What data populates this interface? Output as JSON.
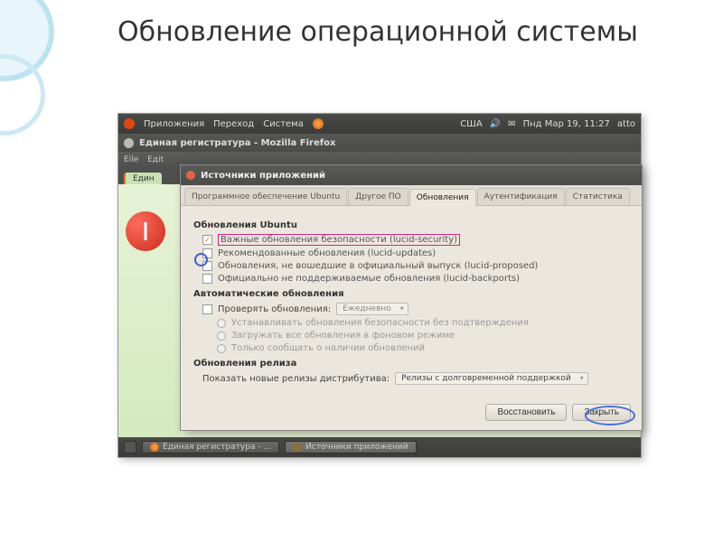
{
  "slide": {
    "title": "Обновление операционной системы"
  },
  "top_panel": {
    "menu": [
      "Приложения",
      "Переход",
      "Система"
    ],
    "status_lang": "США",
    "datetime": "Пнд Мар 19, 11:27",
    "user": "atto"
  },
  "firefox": {
    "title": "Единая регистратура - Mozilla Firefox",
    "menu": [
      "Eile",
      "Едit"
    ],
    "tab": "Един"
  },
  "dialog": {
    "title": "Источники приложений",
    "tabs": [
      "Программное обеспечение Ubuntu",
      "Другое ПО",
      "Обновления",
      "Аутентификация",
      "Статистика"
    ],
    "active_tab": 2,
    "section_updates": "Обновления Ubuntu",
    "opt_security": "Важные обновления безопасности (lucid-security)",
    "opt_recommended": "Рекомендованные обновления (lucid-updates)",
    "opt_proposed": "Обновления, не вошедшие в официальный выпуск (lucid-proposed)",
    "opt_backports": "Официально не поддерживаемые обновления (lucid-backports)",
    "section_auto": "Автоматические обновления",
    "check_label": "Проверять обновления:",
    "check_interval": "Ежедневно",
    "r_install": "Устанавливать обновления безопасности без подтверждения",
    "r_download": "Загружать все обновления в фоновом режиме",
    "r_notify": "Только сообщать о наличии обновлений",
    "section_release": "Обновления релиза",
    "release_label": "Показать новые релизы дистрибутива:",
    "release_value": "Релизы с долговременной поддержкой",
    "btn_restore": "Восстановить",
    "btn_close": "Закрыть"
  },
  "taskbar": {
    "task1": "Единая регистратура - ...",
    "task2": "Источники приложений"
  }
}
